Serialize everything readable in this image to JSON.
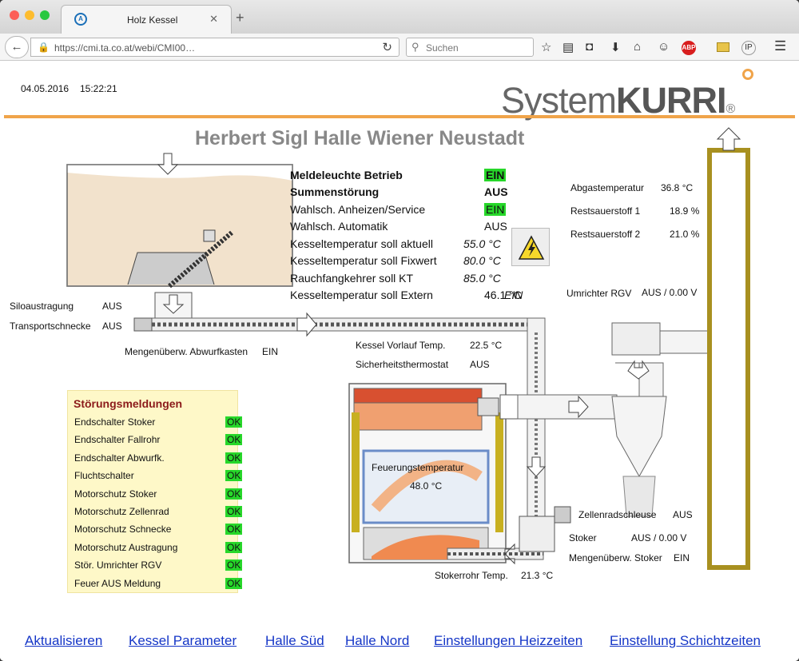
{
  "browser": {
    "tab_title": "Holz Kessel",
    "url": "https://cmi.ta.co.at/webi/CMI00…",
    "search_placeholder": "Suchen",
    "adblock": "ABP",
    "ip": "IP"
  },
  "header": {
    "date": "04.05.2016",
    "time": "15:22:21",
    "brand_light": "System",
    "brand_bold": "KURRI",
    "registered": "®",
    "title": "Herbert Sigl Halle Wiener Neustadt"
  },
  "status": [
    {
      "label": "Meldeleuchte Betrieb",
      "value": "EIN",
      "bold": true,
      "green": true
    },
    {
      "label": "Summenstörung",
      "value": "AUS",
      "bold": true,
      "green": false
    },
    {
      "label": "Wahlsch. Anheizen/Service",
      "value": "EIN",
      "bold": false,
      "green": true
    },
    {
      "label": "Wahlsch. Automatik",
      "value": "AUS",
      "bold": false,
      "green": false
    },
    {
      "label": "Kesseltemperatur soll aktuell",
      "value": "55.0 °C",
      "bold": false,
      "green": false,
      "italic": true
    },
    {
      "label": "Kesseltemperatur soll Fixwert",
      "value": "80.0 °C",
      "bold": false,
      "green": false,
      "italic": true
    },
    {
      "label": "Rauchfangkehrer soll KT",
      "value": "85.0 °C",
      "bold": false,
      "green": false,
      "italic": true
    },
    {
      "label": "Kesseltemperatur soll Extern",
      "value": "46.1 °C",
      "value2": "EIN",
      "bold": false,
      "green": false
    }
  ],
  "exhaust": [
    {
      "label": "Abgastemperatur",
      "value": "36.8 °C"
    },
    {
      "label": "Restsauerstoff 1",
      "value": "18.9 %"
    },
    {
      "label": "Restsauerstoff 2",
      "value": "21.0 %"
    }
  ],
  "plant": {
    "silo_label": "Siloaustragung",
    "silo_value": "AUS",
    "transport_label": "Transportschnecke",
    "transport_value": "AUS",
    "abwurf_label": "Mengenüberw. Abwurfkasten",
    "abwurf_value": "EIN",
    "vorlauf_label": "Kessel Vorlauf Temp.",
    "vorlauf_value": "22.5 °C",
    "stb_label": "Sicherheitsthermostat",
    "stb_value": "AUS",
    "feuer_label": "Feuerungstemperatur",
    "feuer_value": "48.0 °C",
    "rgv_label": "Umrichter RGV",
    "rgv_value": "AUS  / 0.00 V",
    "zellrad_label": "Zellenradschleuse",
    "zellrad_value": "AUS",
    "stoker_label": "Stoker",
    "stoker_value": "AUS  / 0.00 V",
    "mstoker_label": "Mengenüberw. Stoker",
    "mstoker_value": "EIN",
    "stokerrohr_label": "Stokerrohr Temp.",
    "stokerrohr_value": "21.3 °C"
  },
  "stoerungen": {
    "title": "Störungsmeldungen",
    "items": [
      {
        "label": "Endschalter Stoker",
        "value": "OK"
      },
      {
        "label": "Endschalter Fallrohr",
        "value": "OK"
      },
      {
        "label": "Endschalter Abwurfk.",
        "value": "OK"
      },
      {
        "label": "Fluchtschalter",
        "value": "OK"
      },
      {
        "label": "Motorschutz Stoker",
        "value": "OK"
      },
      {
        "label": "Motorschutz Zellenrad",
        "value": "OK"
      },
      {
        "label": "Motorschutz Schnecke",
        "value": "OK"
      },
      {
        "label": "Motorschutz Austragung",
        "value": "OK"
      },
      {
        "label": "Stör. Umrichter RGV",
        "value": "OK"
      },
      {
        "label": "Feuer AUS Meldung",
        "value": "OK"
      }
    ]
  },
  "links": [
    "Aktualisieren",
    "Kessel Parameter",
    "Halle Süd",
    "Halle Nord",
    "Einstellungen Heizzeiten",
    "Einstellung Schichtzeiten"
  ],
  "colors": {
    "accent": "#f0a44a",
    "ok_green": "#27d72a",
    "panel_bg": "#fef8c8",
    "link": "#1536c7",
    "title_gray": "#888888"
  }
}
